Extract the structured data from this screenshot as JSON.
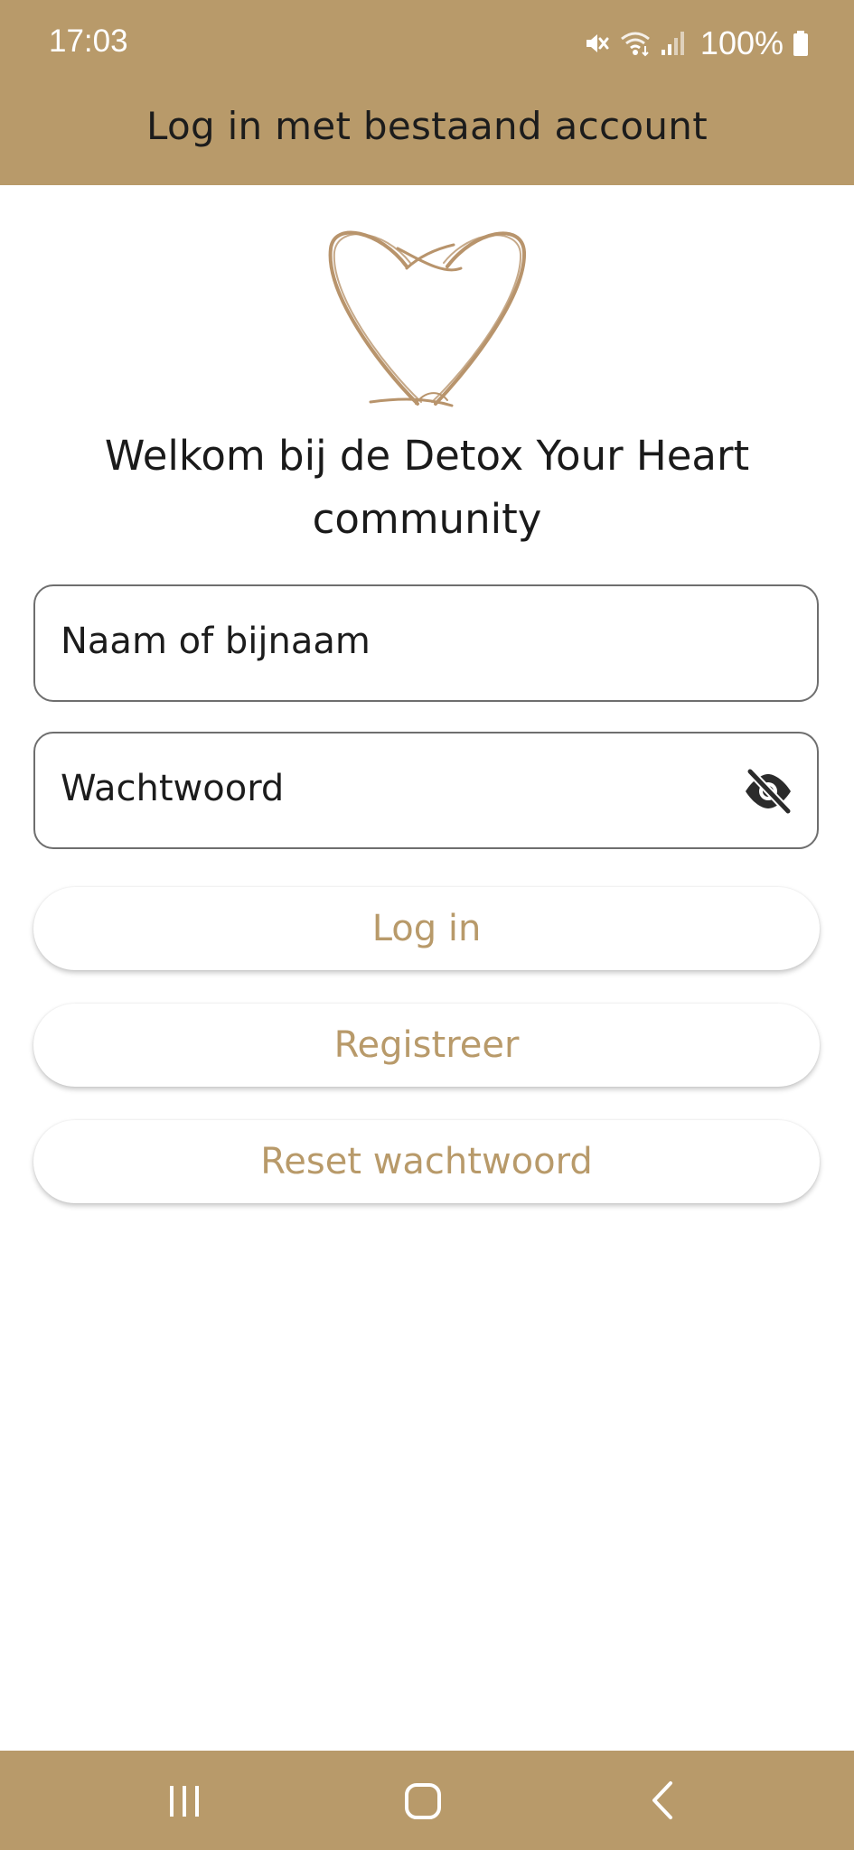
{
  "status_bar": {
    "time": "17:03",
    "battery_text": "100%",
    "icons": [
      "mute-icon",
      "wifi-icon",
      "signal-icon",
      "battery-icon"
    ]
  },
  "header": {
    "title": "Log in met bestaand account"
  },
  "welcome": {
    "text": "Welkom bij de Detox Your Heart community"
  },
  "form": {
    "name_placeholder": "Naam of bijnaam",
    "password_placeholder": "Wachtwoord",
    "password_toggle_icon": "eye-off-icon"
  },
  "buttons": {
    "login": "Log in",
    "register": "Registreer",
    "reset_password": "Reset wachtwoord"
  },
  "navigation": {
    "icons": [
      "recent-apps-icon",
      "home-icon",
      "back-icon"
    ]
  },
  "colors": {
    "brand": "#b89a6a",
    "text": "#1c1c1c",
    "background": "#ffffff"
  }
}
